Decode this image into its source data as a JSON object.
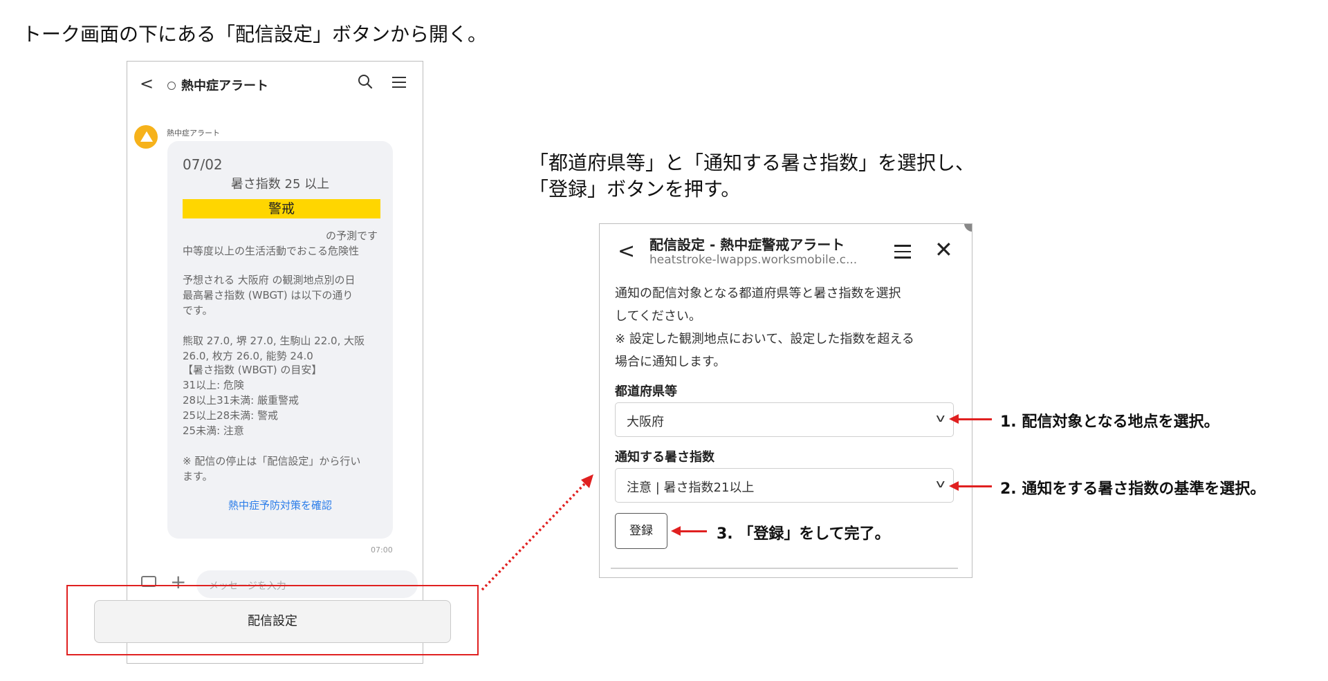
{
  "captions": {
    "step_open": "トーク画面の下にある「配信設定」ボタンから開く。",
    "step_select_line1": "「都道府県等」と「通知する暑さ指数」を選択し、",
    "step_select_line2": "「登録」ボタンを押す。"
  },
  "talk": {
    "header_back": "<",
    "title": "熱中症アラート",
    "sender": "熱中症アラート",
    "date": "07/02",
    "index_line": "暑さ指数 25 以上",
    "warning_label": "警戒",
    "forecast_suffix": "の予測です",
    "lines": [
      "中等度以上の生活活動でおこる危険性",
      "予想される 大阪府 の観測地点別の日",
      "最高暑さ指数 (WBGT) は以下の通り",
      "です。",
      "熊取 27.0, 堺 27.0, 生駒山 22.0, 大阪",
      " 26.0, 枚方 26.0, 能勢 24.0",
      "【暑さ指数 (WBGT) の目安】",
      "31以上: 危険",
      "28以上31未満: 厳重警戒",
      "25以上28未満: 警戒",
      "25未満: 注意",
      "※ 配信の停止は「配信設定」から行い",
      "ます。"
    ],
    "link": "熱中症予防対策を確認",
    "time": "07:00",
    "input_placeholder": "メッセージを入力",
    "plus": "+",
    "settings_button": "配信設定"
  },
  "settings": {
    "back": "<",
    "title": "配信設定 - 熱中症警戒アラート",
    "url": "heatstroke-lwapps.worksmobile.c...",
    "close": "✕",
    "description": "通知の配信対象となる都道府県等と暑さ指数を選択してください。※ 設定した観測地点において、設定した指数を超える場合に通知します。",
    "desc_lines": [
      "通知の配信対象となる都道府県等と暑さ指数を選択",
      "してください。",
      "※ 設定した観測地点において、設定した指数を超える",
      "場合に通知します。"
    ],
    "prefecture_label": "都道府県等",
    "prefecture_value": "大阪府",
    "index_label": "通知する暑さ指数",
    "index_value": "注意 | 暑さ指数21以上",
    "chevron": "v",
    "register_button": "登録"
  },
  "annotations": {
    "step1": "1. 配信対象となる地点を選択。",
    "step2": "2. 通知をする暑さ指数の基準を選択。",
    "step3": "3. 「登録」をして完了。"
  },
  "colors": {
    "warning_yellow": "#ffd600",
    "link_blue": "#2b7de9",
    "highlight_red": "#e02020",
    "avatar_orange": "#f6b21b"
  }
}
